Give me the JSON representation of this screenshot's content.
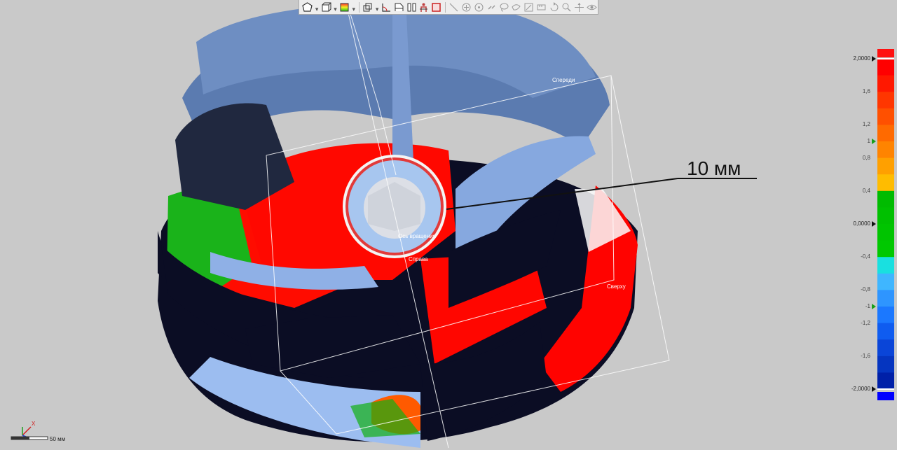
{
  "toolbar": {
    "icons": [
      "polygon-select",
      "box-view",
      "color-map",
      "box-tool",
      "angle-tool",
      "section-tool",
      "pause-split",
      "person-tool",
      "rect-select",
      "line-tool",
      "plus-circle",
      "add-point",
      "link-tool",
      "lasso-tool",
      "edit-tool",
      "rotate-tool",
      "zoom-tool",
      "transform-tool",
      "eye-tool"
    ]
  },
  "annotation": {
    "text": "10 мм"
  },
  "scene_labels": {
    "front": "Спереди",
    "axis": "Ось вращения",
    "right": "Справа",
    "top": "Сверху"
  },
  "scale": {
    "x_label": "X",
    "length": "50 мм"
  },
  "legend": {
    "colors": [
      "#ff0000",
      "#ff1800",
      "#ff3600",
      "#ff5000",
      "#ff6a00",
      "#ff8400",
      "#ffa000",
      "#ffbc00",
      "#00bb00",
      "#00c000",
      "#00c400",
      "#00c800",
      "#19e0e0",
      "#3fb6ff",
      "#2e95ff",
      "#1b78ff",
      "#0f5cf0",
      "#0a45d8",
      "#0535c0",
      "#0020a8"
    ],
    "over_color": "#ff1010",
    "under_color": "#0000ff",
    "top_value": "2,0000",
    "bottom_value": "-2,0000",
    "zero_value": "0,0000",
    "ticks": [
      "1,6",
      "1,2",
      "0,8",
      "0,4",
      "-0,4",
      "-0,8",
      "-1,2",
      "-1,6"
    ],
    "tol_upper": "1",
    "tol_lower": "-1"
  }
}
